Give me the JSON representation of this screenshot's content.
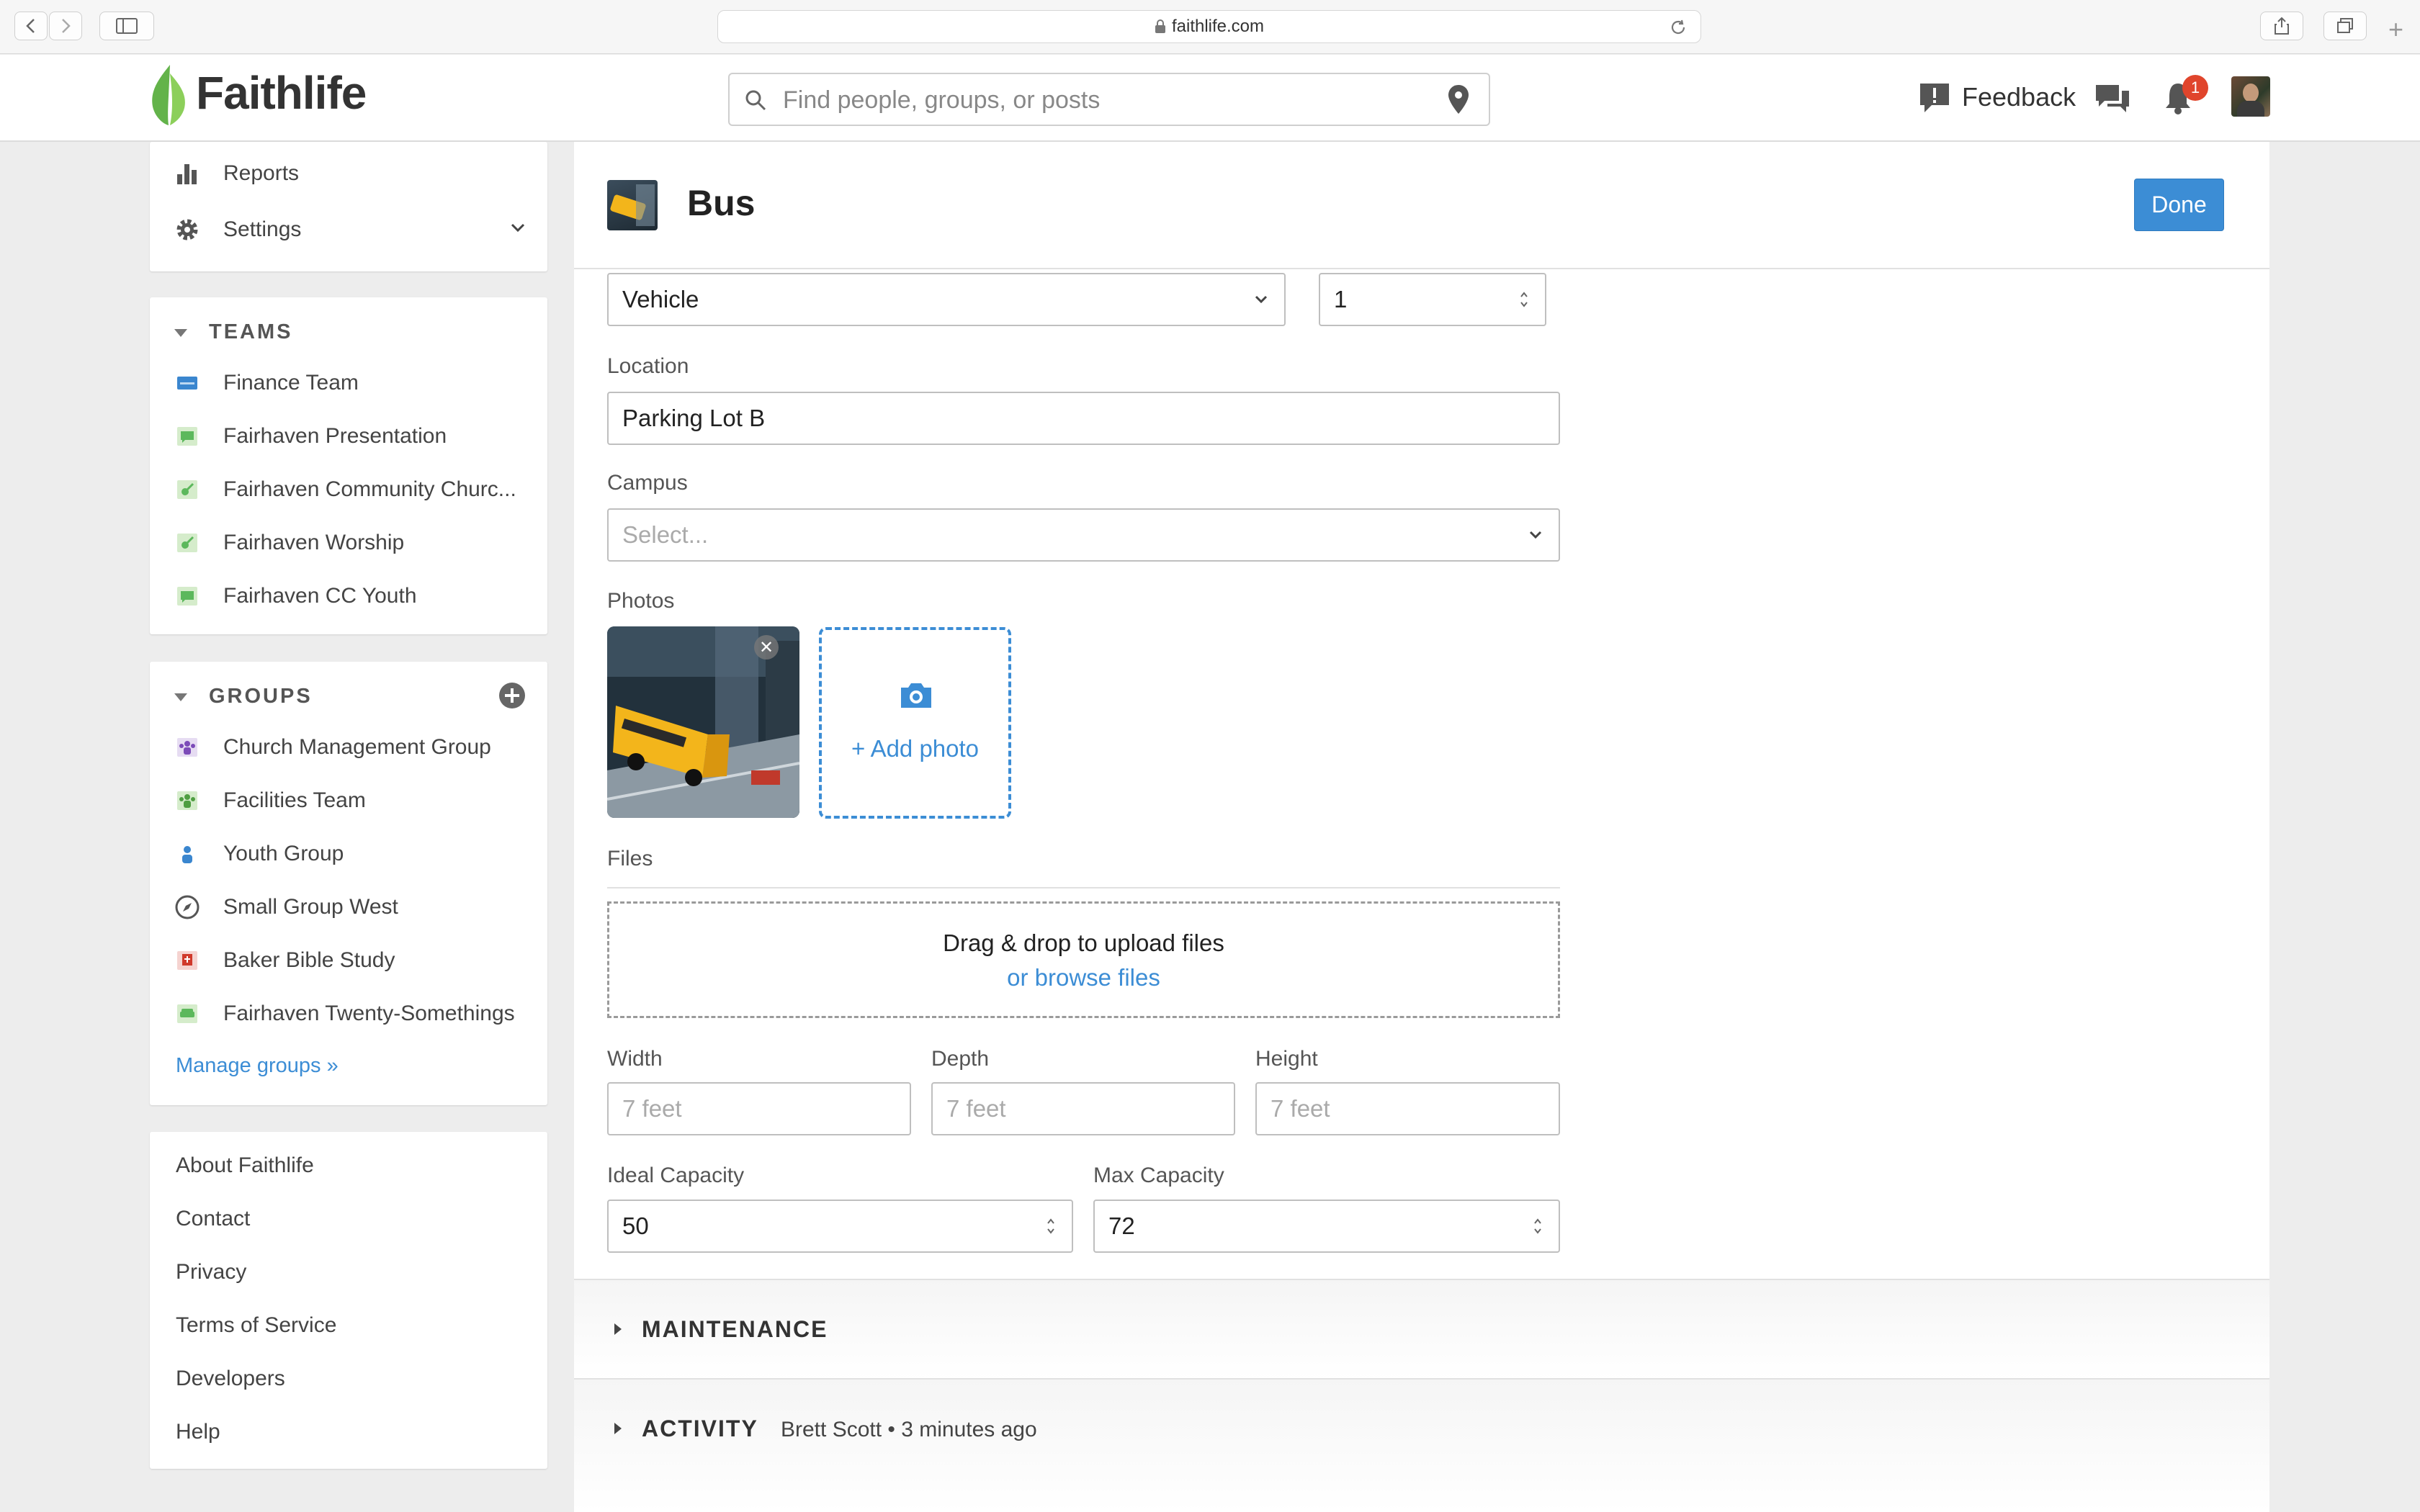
{
  "browser": {
    "url": "faithlife.com"
  },
  "header": {
    "logo": "Faithlife",
    "search_placeholder": "Find people, groups, or posts",
    "feedback_label": "Feedback",
    "notification_count": "1"
  },
  "sidebar": {
    "admin_items": [
      {
        "label": "Reports",
        "icon": "bar-chart-icon"
      },
      {
        "label": "Settings",
        "icon": "gear-icon"
      }
    ],
    "teams": {
      "heading": "TEAMS",
      "items": [
        {
          "label": "Finance Team",
          "icon": "blue-card-icon"
        },
        {
          "label": "Fairhaven Presentation",
          "icon": "green-chat-icon"
        },
        {
          "label": "Fairhaven Community Churc...",
          "icon": "guitar-icon"
        },
        {
          "label": "Fairhaven Worship",
          "icon": "guitar-icon"
        },
        {
          "label": "Fairhaven CC Youth",
          "icon": "green-chat-icon"
        }
      ]
    },
    "groups": {
      "heading": "GROUPS",
      "items": [
        {
          "label": "Church Management Group",
          "icon": "people-purple-icon"
        },
        {
          "label": "Facilities Team",
          "icon": "people-green-icon"
        },
        {
          "label": "Youth Group",
          "icon": "person-blue-icon"
        },
        {
          "label": "Small Group West",
          "icon": "compass-icon"
        },
        {
          "label": "Baker Bible Study",
          "icon": "bible-red-icon"
        },
        {
          "label": "Fairhaven Twenty-Somethings",
          "icon": "couch-green-icon"
        }
      ],
      "manage_link": "Manage groups »"
    },
    "footer_links": [
      "About Faithlife",
      "Contact",
      "Privacy",
      "Terms of Service",
      "Developers",
      "Help"
    ]
  },
  "resource": {
    "title": "Bus",
    "done_label": "Done",
    "type_value": "Vehicle",
    "quantity_value": "1",
    "location_label": "Location",
    "location_value": "Parking Lot B",
    "campus_label": "Campus",
    "campus_placeholder": "Select...",
    "photos_label": "Photos",
    "add_photo_label": "+ Add photo",
    "files_label": "Files",
    "dropzone_text": "Drag & drop to upload files",
    "browse_link": "or browse files",
    "width_label": "Width",
    "width_placeholder": "7 feet",
    "depth_label": "Depth",
    "depth_placeholder": "7 feet",
    "height_label": "Height",
    "height_placeholder": "7 feet",
    "ideal_capacity_label": "Ideal Capacity",
    "ideal_capacity_value": "50",
    "max_capacity_label": "Max Capacity",
    "max_capacity_value": "72"
  },
  "sections": {
    "maintenance": "MAINTENANCE",
    "activity": "ACTIVITY",
    "activity_meta": "Brett Scott • 3 minutes ago"
  },
  "colors": {
    "accent": "#3c8dd5",
    "brand_green": "#5cb85c",
    "badge": "#e0452c"
  }
}
